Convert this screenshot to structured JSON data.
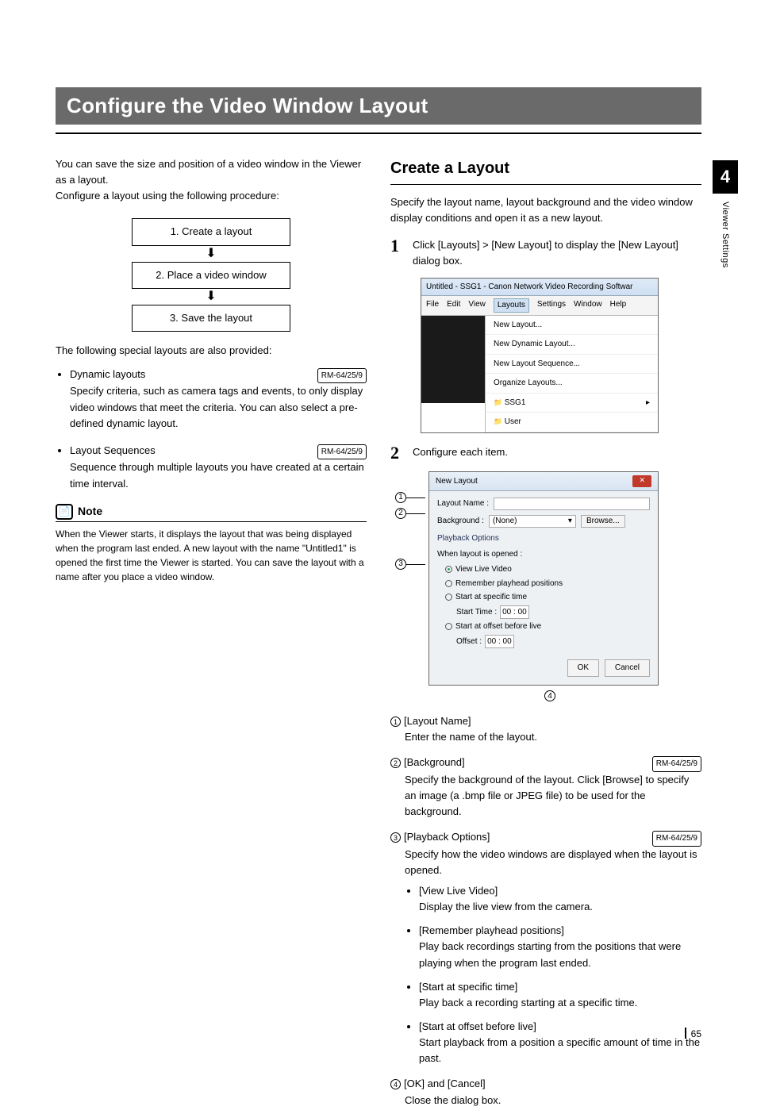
{
  "title": "Configure the Video Window Layout",
  "left": {
    "intro1": "You can save the size and position of a video window in the Viewer as a layout.",
    "intro2": "Configure a layout using the following procedure:",
    "flow": [
      "1. Create a layout",
      "2. Place a video window",
      "3. Save the layout"
    ],
    "following": "The following special layouts are also provided:",
    "bullets": [
      {
        "head": "Dynamic layouts",
        "tag": "RM-64/25/9",
        "body": "Specify criteria, such as camera tags and events, to only display video windows that meet the criteria. You can also select a pre-defined dynamic layout."
      },
      {
        "head": "Layout Sequences",
        "tag": "RM-64/25/9",
        "body": "Sequence through multiple layouts you have created at a certain time interval."
      }
    ],
    "note_label": "Note",
    "note_body": "When the Viewer starts, it displays the layout that was being displayed when the program last ended. A new layout with the name \"Untitled1\" is opened the first time the Viewer is started. You can save the layout with a name after you place a video window."
  },
  "right": {
    "heading": "Create a Layout",
    "intro": "Specify the layout name, layout background and the video window display conditions and open it as a new layout.",
    "steps": {
      "s1": "Click [Layouts] > [New Layout] to display the [New Layout] dialog box.",
      "s2": "Configure each item."
    },
    "ss1": {
      "title": "Untitled - SSG1 - Canon Network Video Recording Softwar",
      "menu": [
        "File",
        "Edit",
        "View",
        "Layouts",
        "Settings",
        "Window",
        "Help"
      ],
      "dropdown": [
        "New Layout...",
        "New Dynamic Layout...",
        "New Layout Sequence...",
        "Organize Layouts...",
        "SSG1",
        "User"
      ]
    },
    "dlg": {
      "title": "New Layout",
      "layout_name_label": "Layout Name :",
      "background_label": "Background :",
      "background_value": "(None)",
      "browse": "Browse...",
      "group": "Playback Options",
      "sub": "When layout is opened :",
      "r1": "View Live Video",
      "r2": "Remember playhead positions",
      "r3": "Start at specific time",
      "start_time_label": "Start Time :",
      "start_time_value": "00 : 00",
      "r4": "Start at offset before live",
      "offset_label": "Offset :",
      "offset_value": "00 : 00",
      "ok": "OK",
      "cancel": "Cancel"
    },
    "enum": [
      {
        "n": "1",
        "title": "[Layout Name]",
        "tag": "",
        "body": "Enter the name of the layout."
      },
      {
        "n": "2",
        "title": "[Background]",
        "tag": "RM-64/25/9",
        "body": "Specify the background of the layout. Click [Browse] to specify an image (a .bmp file or JPEG file) to be used for the background."
      },
      {
        "n": "3",
        "title": "[Playback Options]",
        "tag": "RM-64/25/9",
        "body": "Specify how the video windows are displayed when the layout is opened.",
        "sub": [
          {
            "t": "[View Live Video]",
            "b": "Display the live view from the camera."
          },
          {
            "t": "[Remember playhead positions]",
            "b": "Play back recordings starting from the positions that were playing when the program last ended."
          },
          {
            "t": "[Start at specific time]",
            "b": "Play back a recording starting at a specific time."
          },
          {
            "t": "[Start at offset before live]",
            "b": "Start playback from a position a specific amount of time in the past."
          }
        ]
      },
      {
        "n": "4",
        "title": "[OK] and [Cancel]",
        "tag": "",
        "body": "Close the dialog box."
      }
    ]
  },
  "side": {
    "chapter": "4",
    "label": "Viewer Settings"
  },
  "page_number": "65"
}
